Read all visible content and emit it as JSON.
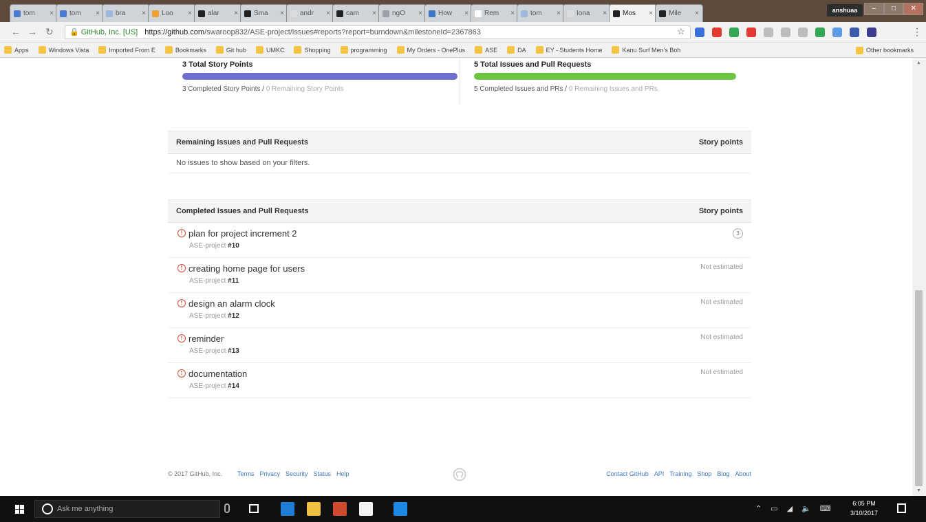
{
  "browser": {
    "tabs": [
      {
        "label": "tom",
        "color": "#4a7bd0"
      },
      {
        "label": "tom",
        "color": "#4a7bd0"
      },
      {
        "label": "bra",
        "color": "#9fb8e0"
      },
      {
        "label": "Loo",
        "color": "#f0a030"
      },
      {
        "label": "alar",
        "color": "#222222"
      },
      {
        "label": "Sma",
        "color": "#222222"
      },
      {
        "label": "andr",
        "color": "#dddddd"
      },
      {
        "label": "cam",
        "color": "#222222"
      },
      {
        "label": "ngO",
        "color": "#9aa0aa"
      },
      {
        "label": "How",
        "color": "#3b79c4"
      },
      {
        "label": "Rem",
        "color": "#ffffff"
      },
      {
        "label": "tom",
        "color": "#9fb8e0"
      },
      {
        "label": "Iona",
        "color": "#dddddd"
      },
      {
        "label": "Mos",
        "color": "#222222",
        "active": true
      },
      {
        "label": "Mile",
        "color": "#222222"
      }
    ],
    "user_chip": "anshuaa",
    "url_org": "GitHub, Inc. [US]",
    "url_host": "https://github.com",
    "url_path": "/swaroop832/ASE-project/issues#reports?report=burndown&milestoneId=2367863",
    "extension_colors": [
      "#3b6fd8",
      "#e23b2e",
      "#35a853",
      "#e53935",
      "#bdbdbd",
      "#bdbdbd",
      "#bdbdbd",
      "#34a853",
      "#5c9be6",
      "#3a5ba9",
      "#3d3d8f"
    ],
    "bookmarks": [
      "Apps",
      "Windows Vista",
      "Imported From E",
      "Bookmarks",
      "Git hub",
      "UMKC",
      "Shopping",
      "programming",
      "My Orders - OnePlus",
      "ASE",
      "DA",
      "EY - Students Home",
      "Kanu Surf Men's Boh"
    ],
    "bookmarks_other": "Other bookmarks"
  },
  "summary": {
    "story_title": "3 Total Story Points",
    "story_completed": "3 Completed Story Points",
    "story_remaining": "0 Remaining Story Points",
    "issues_title": "5 Total Issues and Pull Requests",
    "issues_completed": "5 Completed Issues and PRs",
    "issues_remaining": "0 Remaining Issues and PRs",
    "story_bar_color": "#6f6fcf",
    "issues_bar_color": "#6cc644",
    "story_progress": 1.0,
    "issues_progress": 1.0
  },
  "remaining": {
    "heading": "Remaining Issues and Pull Requests",
    "points_heading": "Story points",
    "empty_text": "No issues to show based on your filters."
  },
  "completed": {
    "heading": "Completed Issues and Pull Requests",
    "points_heading": "Story points",
    "issues": [
      {
        "title": "plan for project increment 2",
        "repo": "ASE-project",
        "number": "#10",
        "points": "3"
      },
      {
        "title": "creating home page for users",
        "repo": "ASE-project",
        "number": "#11",
        "points": "Not estimated"
      },
      {
        "title": "design an alarm clock",
        "repo": "ASE-project",
        "number": "#12",
        "points": "Not estimated"
      },
      {
        "title": "reminder",
        "repo": "ASE-project",
        "number": "#13",
        "points": "Not estimated"
      },
      {
        "title": "documentation",
        "repo": "ASE-project",
        "number": "#14",
        "points": "Not estimated"
      }
    ]
  },
  "footer": {
    "copyright": "© 2017 GitHub, Inc.",
    "links_left": [
      "Terms",
      "Privacy",
      "Security",
      "Status",
      "Help"
    ],
    "links_right": [
      "Contact GitHub",
      "API",
      "Training",
      "Shop",
      "Blog",
      "About"
    ]
  },
  "taskbar": {
    "search_placeholder": "Ask me anything",
    "time": "6:05 PM",
    "date": "3/10/2017",
    "app_colors": [
      "#1e7fd6",
      "#f0c040",
      "#d04a30",
      "#f3f3f3",
      "#1e88e5"
    ]
  }
}
